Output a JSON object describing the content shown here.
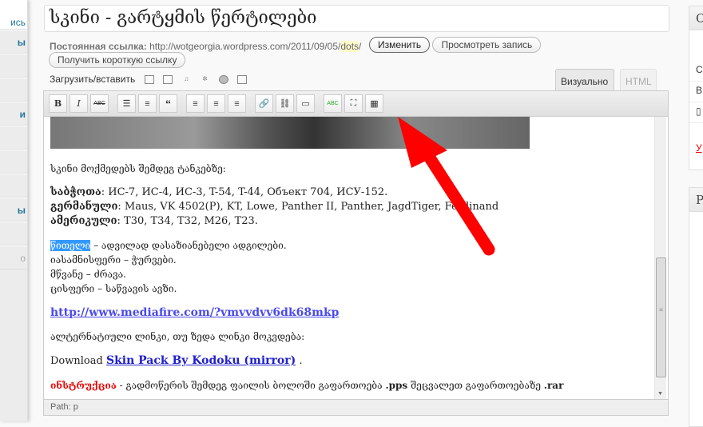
{
  "sidebar": {
    "items": [
      "ись",
      "ы",
      "",
      "",
      "и",
      "",
      "",
      "",
      "ы",
      "",
      "о"
    ]
  },
  "post": {
    "title": "სკინი - გარტყმის წერტილები"
  },
  "permalink": {
    "label": "Постоянная ссылка:",
    "url_prefix": "http://wotgeorgia.wordpress.com/2011/09/05/",
    "slug": "dots",
    "url_suffix": "/",
    "edit_button": "Изменить",
    "view_button": "Просмотреть запись",
    "shortlink_button": "Получить короткую ссылку"
  },
  "upload": {
    "label": "Загрузить/вставить"
  },
  "tabs": {
    "visual": "Визуально",
    "html": "HTML"
  },
  "toolbar": {
    "bold": "B",
    "italic": "I",
    "strike": "ABC",
    "spell": "ABC"
  },
  "content": {
    "intro": "სკინი მოქმედებს შემდეგ ტანკებზე:",
    "soviet_label": "საბჭოთა",
    "soviet": ": ИС-7, ИС-4, ИС-3, T-54, T-44, Объект 704, ИСУ-152.",
    "german_label": "გერმანული",
    "german": ": Maus, VK 4502(P), KT, Lowe, Panther II, Panther, JagdTiger, Ferdinand",
    "american_label": "ამერიკული",
    "american": ": T30, T34, T32, M26, T23.",
    "red_selected": "წითელი",
    "red_rest": " – ადვილად დასაზიანებელი ადგილები.",
    "purple": "იასამნისფერი – ჭურვები.",
    "green": "მწვანე – ძრავა.",
    "blue": "ცისფერი – საწვავის ავზი.",
    "link1": "http://www.mediafire.com/?vmvvdvv6dk68mkp",
    "alt": "ალტერნატიული ლინკი, თუ ზედა ლინკი მოკვდება:",
    "download": "Download ",
    "link2": "Skin Pack By Kodoku (mirror)",
    "dot": " .",
    "instr_label": "ინსტრუქცია",
    "instr": " - გადმოწერის შემდეგ ფაილის ბოლოში გაფართოება ",
    "pps": ".pps",
    "instr2": " შეცვალეთ გაფართოებაზე ",
    "rar": ".rar"
  },
  "path": {
    "text": "Path: p"
  },
  "right": {
    "panel1_head": "С",
    "row1": "С",
    "row2": "В",
    "row3": "У",
    "panel2_head": "Р"
  },
  "colors": {
    "arrow": "#ff0000",
    "link": "#2020cc",
    "selection": "#3399ff"
  }
}
